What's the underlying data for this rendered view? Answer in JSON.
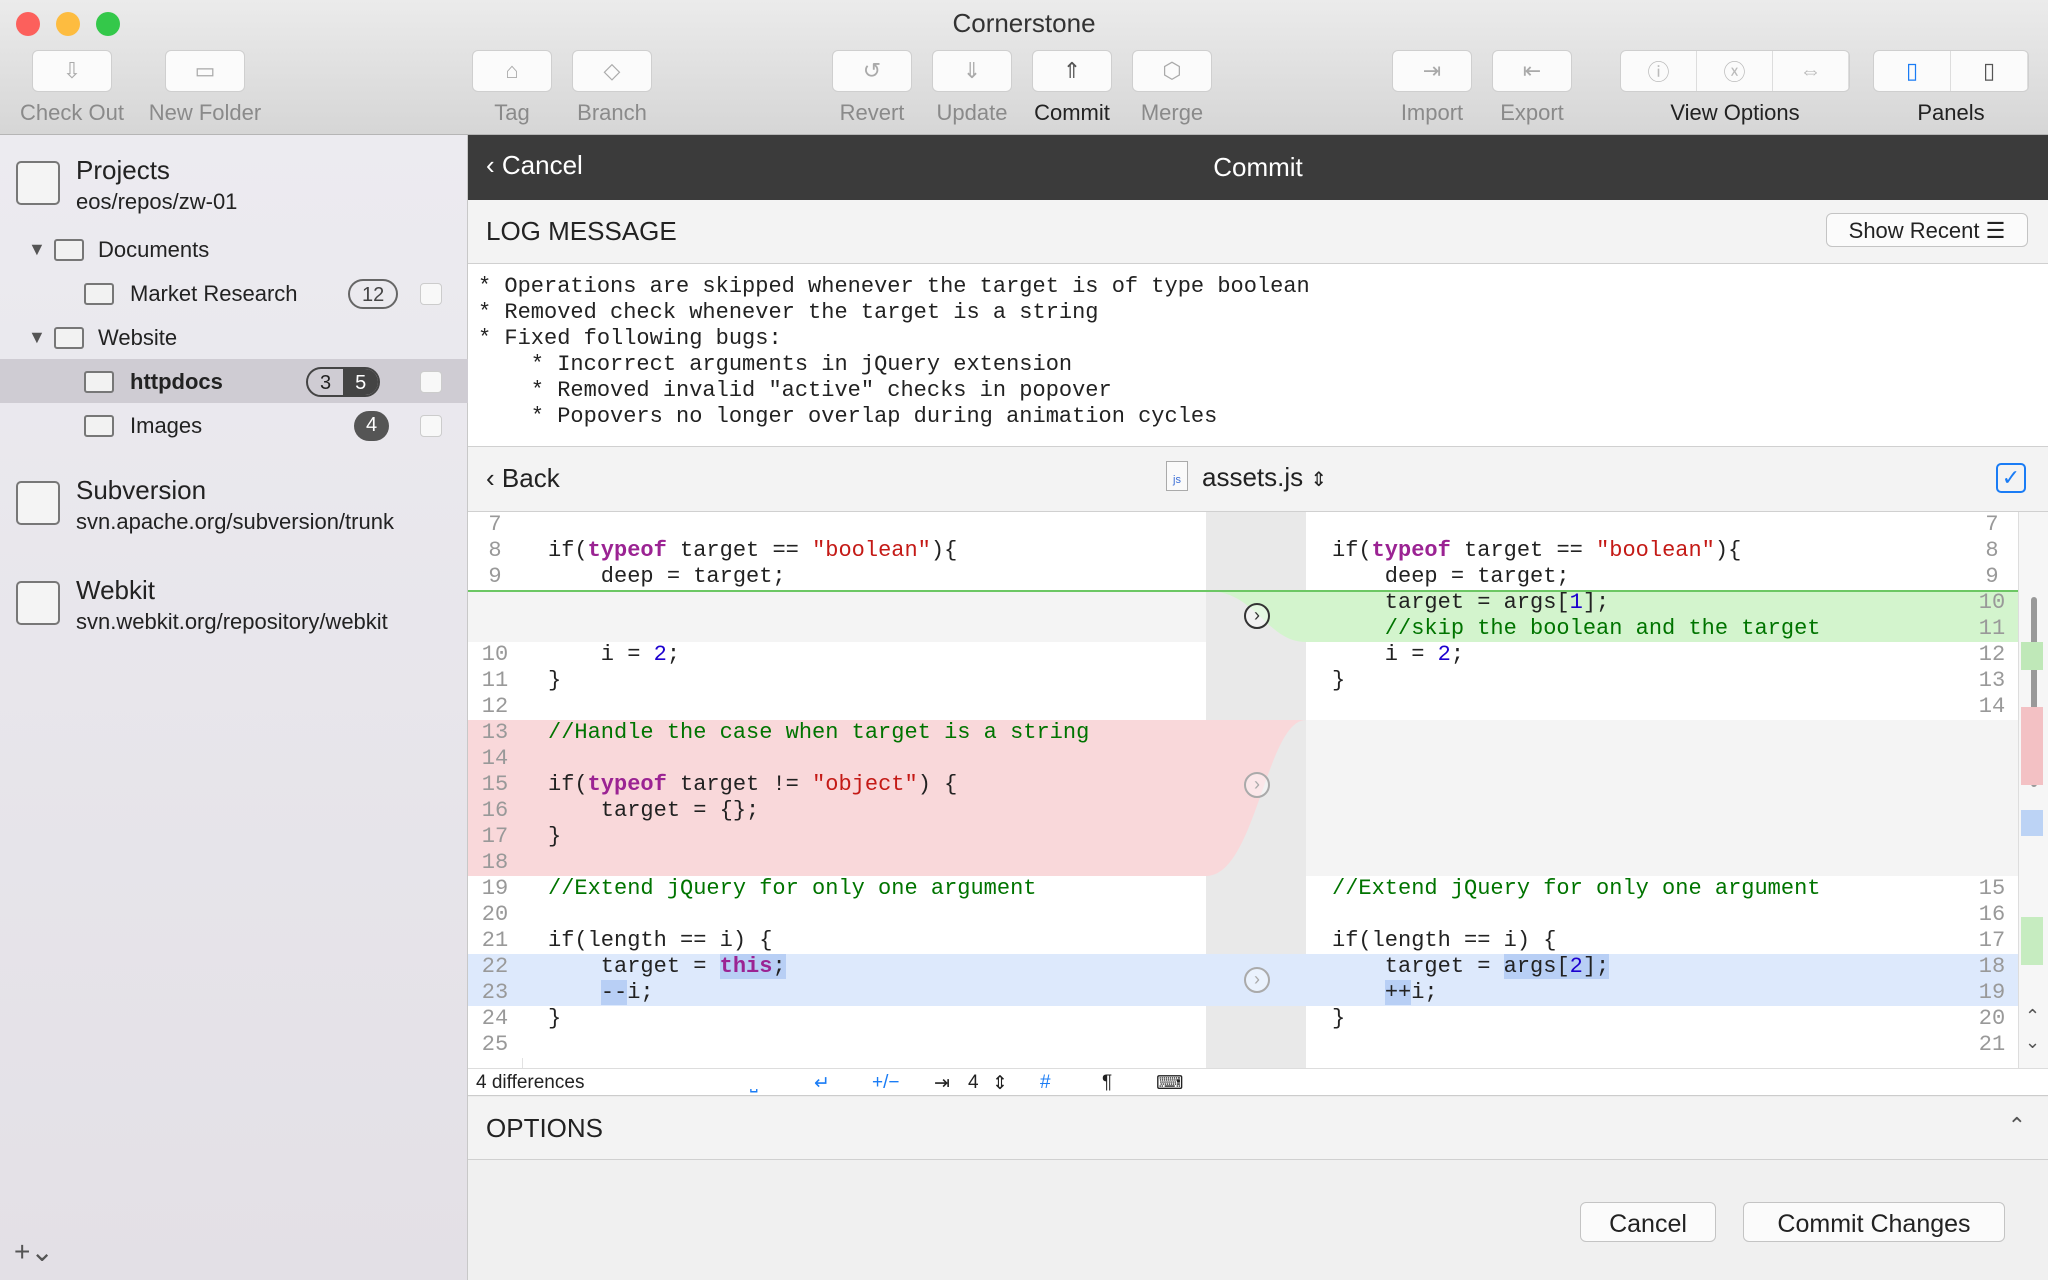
{
  "window": {
    "title": "Cornerstone"
  },
  "toolbar": {
    "check_out": "Check Out",
    "new_folder": "New Folder",
    "tag": "Tag",
    "branch": "Branch",
    "revert": "Revert",
    "update": "Update",
    "commit": "Commit",
    "merge": "Merge",
    "import": "Import",
    "export": "Export",
    "view_options": "View Options",
    "panels": "Panels"
  },
  "sidebar": {
    "projects": {
      "name": "Projects",
      "path": "eos/repos/zw-01"
    },
    "documents": "Documents",
    "market_research": "Market Research",
    "market_badge": "12",
    "website": "Website",
    "httpdocs": "httpdocs",
    "httpdocs_badge_a": "3",
    "httpdocs_badge_b": "5",
    "images": "Images",
    "images_badge": "4",
    "subversion": {
      "name": "Subversion",
      "path": "svn.apache.org/subversion/trunk"
    },
    "webkit": {
      "name": "Webkit",
      "path": "svn.webkit.org/repository/webkit"
    },
    "add": "+⌄"
  },
  "commit": {
    "cancel": "Cancel",
    "title": "Commit",
    "log_heading": "LOG MESSAGE",
    "show_recent": "Show Recent",
    "log_message": "* Operations are skipped whenever the target is of type boolean\n* Removed check whenever the target is a string\n* Fixed following bugs:\n    * Incorrect arguments in jQuery extension\n    * Removed invalid \"active\" checks in popover\n    * Popovers no longer overlap during animation cycles",
    "back": "Back",
    "file": "assets.js",
    "differences": "4 differences",
    "tab_width": "4",
    "options": "OPTIONS",
    "cancel_button": "Cancel",
    "commit_button": "Commit Changes"
  },
  "diff": [
    {
      "k": "same",
      "l": "7",
      "r": "7",
      "lc": [],
      "rc": []
    },
    {
      "k": "same",
      "l": "8",
      "r": "8",
      "lc": [
        [
          "",
          "if("
        ],
        [
          "kw",
          "typeof"
        ],
        [
          "",
          " target == "
        ],
        [
          "str",
          "\"boolean\""
        ],
        [
          "",
          "){"
        ]
      ],
      "rc": [
        [
          "",
          "if("
        ],
        [
          "kw",
          "typeof"
        ],
        [
          "",
          " target == "
        ],
        [
          "str",
          "\"boolean\""
        ],
        [
          "",
          "){"
        ]
      ]
    },
    {
      "k": "same",
      "l": "9",
      "r": "9",
      "lc": [
        [
          "",
          "    deep = target;"
        ]
      ],
      "rc": [
        [
          "",
          "    deep = target;"
        ]
      ]
    },
    {
      "k": "add",
      "l": "",
      "r": "10",
      "lc": [],
      "rc": [
        [
          "",
          "    target = args["
        ],
        [
          "num",
          "1"
        ],
        [
          "",
          "];"
        ]
      ]
    },
    {
      "k": "add",
      "l": "",
      "r": "11",
      "lc": [],
      "rc": [
        [
          "com",
          "    //skip the boolean and the target"
        ]
      ]
    },
    {
      "k": "same",
      "l": "10",
      "r": "12",
      "lc": [
        [
          "",
          "    i = "
        ],
        [
          "num",
          "2"
        ],
        [
          "",
          ";"
        ]
      ],
      "rc": [
        [
          "",
          "    i = "
        ],
        [
          "num",
          "2"
        ],
        [
          "",
          ";"
        ]
      ]
    },
    {
      "k": "same",
      "l": "11",
      "r": "13",
      "lc": [
        [
          "",
          "}"
        ]
      ],
      "rc": [
        [
          "",
          "}"
        ]
      ]
    },
    {
      "k": "same",
      "l": "12",
      "r": "14",
      "lc": [],
      "rc": []
    },
    {
      "k": "del",
      "l": "13",
      "r": "",
      "lc": [
        [
          "com",
          "//Handle the case when target is a string"
        ]
      ],
      "rc": []
    },
    {
      "k": "del",
      "l": "14",
      "r": "",
      "lc": [],
      "rc": []
    },
    {
      "k": "del",
      "l": "15",
      "r": "",
      "lc": [
        [
          "",
          "if("
        ],
        [
          "kw",
          "typeof"
        ],
        [
          "",
          " target != "
        ],
        [
          "str",
          "\"object\""
        ],
        [
          "",
          ") {"
        ]
      ],
      "rc": []
    },
    {
      "k": "del",
      "l": "16",
      "r": "",
      "lc": [
        [
          "",
          "    target = {};"
        ]
      ],
      "rc": []
    },
    {
      "k": "del",
      "l": "17",
      "r": "",
      "lc": [
        [
          "",
          "}"
        ]
      ],
      "rc": []
    },
    {
      "k": "del",
      "l": "18",
      "r": "",
      "lc": [],
      "rc": []
    },
    {
      "k": "same",
      "l": "19",
      "r": "15",
      "lc": [
        [
          "com",
          "//Extend jQuery for only one argument"
        ]
      ],
      "rc": [
        [
          "com",
          "//Extend jQuery for only one argument"
        ]
      ]
    },
    {
      "k": "same",
      "l": "20",
      "r": "16",
      "lc": [],
      "rc": []
    },
    {
      "k": "same",
      "l": "21",
      "r": "17",
      "lc": [
        [
          "",
          "if(length == i) {"
        ]
      ],
      "rc": [
        [
          "",
          "if(length == i) {"
        ]
      ]
    },
    {
      "k": "chg",
      "l": "22",
      "r": "18",
      "lc": [
        [
          "",
          "    target = "
        ],
        [
          "kw hl",
          "this"
        ],
        [
          "hl",
          ";"
        ]
      ],
      "rc": [
        [
          "",
          "    target = "
        ],
        [
          "hl",
          "args["
        ],
        [
          "num hl",
          "2"
        ],
        [
          "hl",
          "];"
        ]
      ]
    },
    {
      "k": "chg",
      "l": "23",
      "r": "19",
      "lc": [
        [
          "",
          "    "
        ],
        [
          "hl",
          "--"
        ],
        [
          "",
          "i;"
        ]
      ],
      "rc": [
        [
          "",
          "    "
        ],
        [
          "hl",
          "++"
        ],
        [
          "",
          "i;"
        ]
      ]
    },
    {
      "k": "same",
      "l": "24",
      "r": "20",
      "lc": [
        [
          "",
          "}"
        ]
      ],
      "rc": [
        [
          "",
          "}"
        ]
      ]
    },
    {
      "k": "same",
      "l": "25",
      "r": "21",
      "lc": [],
      "rc": []
    }
  ],
  "colors": {
    "add": "#d3f4cd",
    "del": "#f9d8da",
    "chg": "#dde9fc",
    "accent": "#1a7cf5"
  }
}
